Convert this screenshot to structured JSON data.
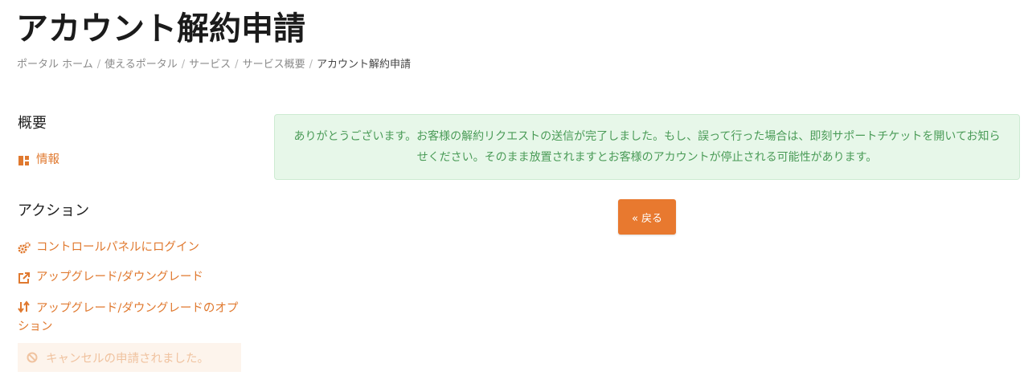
{
  "page": {
    "title": "アカウント解約申請"
  },
  "breadcrumb": {
    "items": [
      "ポータル ホーム",
      "使えるポータル",
      "サービス",
      "サービス概要"
    ],
    "current": "アカウント解約申請"
  },
  "sidebar": {
    "overview_heading": "概要",
    "overview_items": [
      {
        "label": "情報",
        "icon": "dashboard-icon"
      }
    ],
    "actions_heading": "アクション",
    "action_items": [
      {
        "label": "コントロールパネルにログイン",
        "icon": "cogs-icon"
      },
      {
        "label": "アップグレード/ダウングレード",
        "icon": "external-link-icon"
      },
      {
        "label": "アップグレード/ダウングレードのオプション",
        "icon": "sort-arrows-icon"
      }
    ],
    "disabled_item": {
      "label": "キャンセルの申請されました。",
      "icon": "ban-icon"
    }
  },
  "alert": {
    "message": "ありがとうございます。お客様の解約リクエストの送信が完了しました。もし、誤って行った場合は、即刻サポートチケットを開いてお知らせください。そのまま放置されますとお客様のアカウントが停止される可能性があります。"
  },
  "back_button": {
    "label": "« 戻る"
  },
  "colors": {
    "accent": "#e8792f",
    "alert_bg": "#e7f7e9",
    "alert_text": "#4a9b57",
    "disabled_bg": "#fdf4ec",
    "disabled_text": "#f0c3a0"
  }
}
